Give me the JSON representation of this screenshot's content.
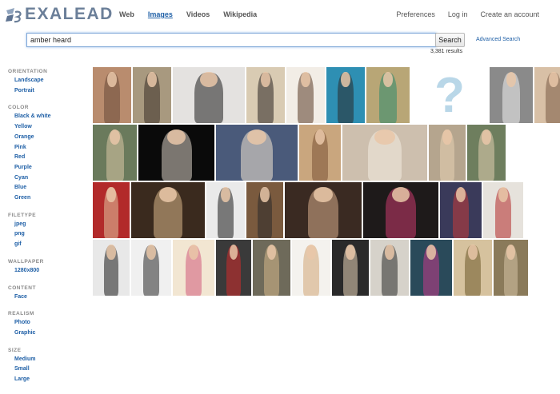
{
  "logo": {
    "text": "EXALEAD",
    "color": "#6b7f99"
  },
  "nav": [
    {
      "label": "Web",
      "active": false
    },
    {
      "label": "Images",
      "active": true
    },
    {
      "label": "Videos",
      "active": false
    },
    {
      "label": "Wikipedia",
      "active": false
    }
  ],
  "right_nav": [
    {
      "label": "Preferences"
    },
    {
      "label": "Log in"
    },
    {
      "label": "Create an account"
    }
  ],
  "search": {
    "query": "amber heard",
    "button": "Search",
    "advanced": "Advanced Search",
    "results": "3,381 results"
  },
  "facets": [
    {
      "title": "ORIENTATION",
      "items": [
        "Landscape",
        "Portrait"
      ]
    },
    {
      "title": "COLOR",
      "items": [
        "Black & white",
        "Yellow",
        "Orange",
        "Pink",
        "Red",
        "Purple",
        "Cyan",
        "Blue",
        "Green"
      ]
    },
    {
      "title": "FILETYPE",
      "items": [
        "jpeg",
        "png",
        "gif"
      ]
    },
    {
      "title": "WALLPAPER",
      "items": [
        "1280x800"
      ]
    },
    {
      "title": "CONTENT",
      "items": [
        "Face"
      ]
    },
    {
      "title": "REALISM",
      "items": [
        "Photo",
        "Graphic"
      ]
    },
    {
      "title": "SIZE",
      "items": [
        "Medium",
        "Small",
        "Large"
      ]
    }
  ],
  "images": [
    [
      {
        "bg": "#b98c6e",
        "fg": "#6a4a3a"
      },
      {
        "bg": "#a8997f",
        "fg": "#3a3028"
      },
      {
        "bg": "#e4e2e0",
        "fg": "#1e1e1e"
      },
      {
        "bg": "#d9cbb3",
        "fg": "#2a2420"
      },
      {
        "bg": "#f2ede6",
        "fg": "#5a3a26"
      },
      {
        "bg": "#2e8fb3",
        "fg": "#2a2a2a"
      },
      {
        "bg": "#b8a676",
        "fg": "#2e8a6e"
      },
      {
        "qmark": "?"
      },
      {
        "bg": "#8a8a8a",
        "fg": "#f0f0f0"
      },
      {
        "bg": "#d8c0a6",
        "fg": "#7a5a44"
      }
    ],
    [
      {
        "bg": "#6a7a5c",
        "fg": "#d8c6a6"
      },
      {
        "bg": "#0a0a0a",
        "fg": "#d8cfc4"
      },
      {
        "bg": "#4a5a7a",
        "fg": "#f2e6d2"
      },
      {
        "bg": "#c9a67e",
        "fg": "#7a5234"
      },
      {
        "bg": "#cdbfae",
        "fg": "#f4ece2"
      },
      {
        "bg": "#b5a58e",
        "fg": "#e6d2b2"
      },
      {
        "bg": "#6e7e5e",
        "fg": "#e2cdb0"
      }
    ],
    [
      {
        "bg": "#b22a2a",
        "fg": "#e2c29e"
      },
      {
        "bg": "#3a2a1e",
        "fg": "#d9b68a"
      },
      {
        "bg": "#eaeaea",
        "fg": "#1a1a1a"
      },
      {
        "bg": "#7a5a3e",
        "fg": "#2a2a2a"
      },
      {
        "bg": "#3a2a22",
        "fg": "#d6ab8a"
      },
      {
        "bg": "#1e1a1a",
        "fg": "#c83a6e"
      },
      {
        "bg": "#3a3a5a",
        "fg": "#c23a3a"
      },
      {
        "bg": "#e6e2dc",
        "fg": "#b22a2a"
      }
    ],
    [
      {
        "bg": "#e8e8e8",
        "fg": "#1a1a1a"
      },
      {
        "bg": "#f0f0f0",
        "fg": "#2a2a2a"
      },
      {
        "bg": "#f2e6d2",
        "fg": "#d25a7a"
      },
      {
        "bg": "#3a3a3a",
        "fg": "#d22a2a"
      },
      {
        "bg": "#6e6a5a",
        "fg": "#d6b68a"
      },
      {
        "bg": "#f4f2ee",
        "fg": "#d2a676"
      },
      {
        "bg": "#2a2a2a",
        "fg": "#e6d2b6"
      },
      {
        "bg": "#d6d2ca",
        "fg": "#2a2a2a"
      },
      {
        "bg": "#2a4a5a",
        "fg": "#c23a8a"
      },
      {
        "bg": "#d6c29e",
        "fg": "#6e5a2a"
      },
      {
        "bg": "#8a7a5a",
        "fg": "#d6c2a6"
      }
    ]
  ]
}
